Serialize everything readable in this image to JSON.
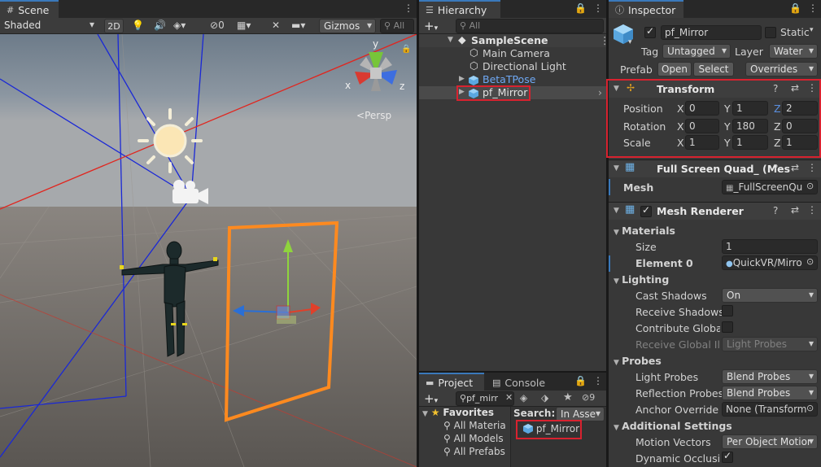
{
  "scene": {
    "tab_label": "Scene",
    "shading_mode": "Shaded",
    "btn_2d": "2D",
    "fx_count": "0",
    "gizmos_label": "Gizmos",
    "search_placeholder": "All",
    "persp_label": "Persp",
    "axis_y": "y",
    "axis_x": "x",
    "axis_z": "z"
  },
  "hierarchy": {
    "tab_label": "Hierarchy",
    "add_label": "+",
    "search_placeholder": "All",
    "items": [
      {
        "label": "SampleScene"
      },
      {
        "label": "Main Camera"
      },
      {
        "label": "Directional Light"
      },
      {
        "label": "BetaTPose"
      },
      {
        "label": "pf_Mirror"
      }
    ]
  },
  "project": {
    "tab_project": "Project",
    "tab_console": "Console",
    "add_label": "+",
    "search_value": "pf_mirr",
    "hidden_count": "9",
    "favorites_label": "Favorites",
    "favorites": [
      {
        "label": "All Materia"
      },
      {
        "label": "All Models"
      },
      {
        "label": "All Prefabs"
      }
    ],
    "search_label": "Search:",
    "search_scope": "In Asse",
    "result": "pf_Mirror"
  },
  "inspector": {
    "tab_label": "Inspector",
    "object_name": "pf_Mirror",
    "static_label": "Static",
    "tag_label": "Tag",
    "tag_value": "Untagged",
    "layer_label": "Layer",
    "layer_value": "Water",
    "prefab_label": "Prefab",
    "open_label": "Open",
    "select_label": "Select",
    "overrides_label": "Overrides",
    "transform": {
      "title": "Transform",
      "position_label": "Position",
      "rotation_label": "Rotation",
      "scale_label": "Scale",
      "x": "X",
      "y": "Y",
      "z": "Z",
      "position": [
        "0",
        "1",
        "2"
      ],
      "rotation": [
        "0",
        "180",
        "0"
      ],
      "scale": [
        "1",
        "1",
        "1"
      ]
    },
    "mesh_filter": {
      "title": "Full Screen Quad_ (Mes",
      "mesh_label": "Mesh",
      "mesh_value": "_FullScreenQu"
    },
    "mesh_renderer": {
      "title": "Mesh Renderer",
      "materials_label": "Materials",
      "size_label": "Size",
      "size_value": "1",
      "element0_label": "Element 0",
      "element0_value": "QuickVR/Mirro",
      "lighting_label": "Lighting",
      "cast_shadows_label": "Cast Shadows",
      "cast_shadows_value": "On",
      "receive_shadows_label": "Receive Shadows",
      "contribute_gi_label": "Contribute Global I",
      "receive_gi_label": "Receive Global Illu",
      "receive_gi_value": "Light Probes",
      "probes_label": "Probes",
      "light_probes_label": "Light Probes",
      "light_probes_value": "Blend Probes",
      "reflection_probes_label": "Reflection Probes",
      "reflection_probes_value": "Blend Probes",
      "anchor_override_label": "Anchor Override",
      "anchor_override_value": "None (Transform",
      "additional_label": "Additional Settings",
      "motion_vectors_label": "Motion Vectors",
      "motion_vectors_value": "Per Object Motior",
      "dynamic_occlusion_label": "Dynamic Occlusio"
    }
  },
  "colors": {
    "accent": "#3a79bb",
    "highlight_box": "#d8222f",
    "selection_outline": "#ff8a1f",
    "prefab_text": "#6fa9f5"
  }
}
